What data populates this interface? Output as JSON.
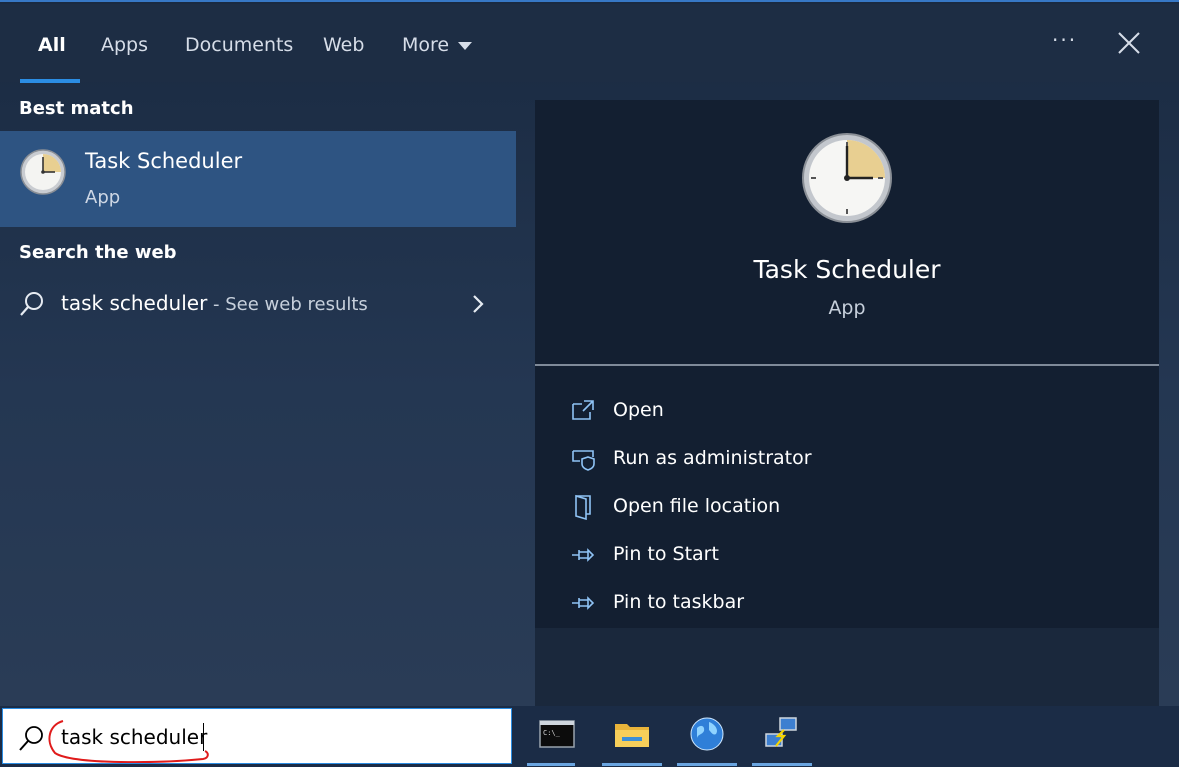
{
  "tabs": [
    {
      "label": "All",
      "active": true
    },
    {
      "label": "Apps"
    },
    {
      "label": "Documents"
    },
    {
      "label": "Web"
    },
    {
      "label": "More"
    }
  ],
  "header": {
    "more_options_icon": "ellipsis-icon",
    "close_icon": "close-icon"
  },
  "left": {
    "best_match_heading": "Best match",
    "best_match": {
      "title": "Task Scheduler",
      "subtitle": "App",
      "icon": "clock-icon"
    },
    "search_web_heading": "Search the web",
    "web_result": {
      "term": "task scheduler",
      "hint": " - See web results"
    }
  },
  "detail": {
    "title": "Task Scheduler",
    "subtitle": "App",
    "actions": [
      {
        "label": "Open",
        "icon": "open-icon"
      },
      {
        "label": "Run as administrator",
        "icon": "shield-icon"
      },
      {
        "label": "Open file location",
        "icon": "folder-location-icon"
      },
      {
        "label": "Pin to Start",
        "icon": "pin-icon"
      },
      {
        "label": "Pin to taskbar",
        "icon": "pin-icon"
      }
    ]
  },
  "taskbar": {
    "search_value": "task scheduler",
    "apps": [
      "command-prompt-icon",
      "file-explorer-icon",
      "internet-globe-icon",
      "network-icon"
    ]
  },
  "colors": {
    "accent": "#2b8de3",
    "selected": "#2e5482",
    "annotation": "#e01b1b"
  }
}
